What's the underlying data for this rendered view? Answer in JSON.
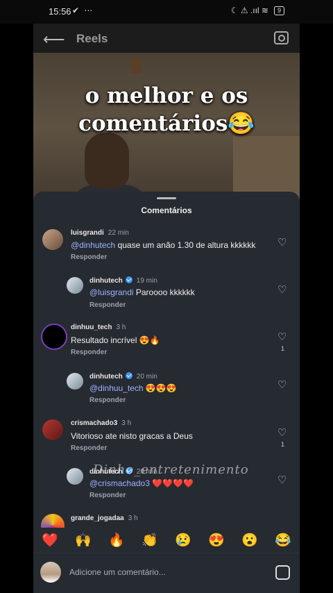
{
  "status_bar": {
    "time": "15:56",
    "left_icons": "✔ ⋯",
    "right_icons": "☾ ⚠ .ııl ≋",
    "battery": "9"
  },
  "app_bar": {
    "title": "Reels",
    "back_icon": "arrow-left-icon",
    "camera_icon": "camera-icon"
  },
  "video": {
    "overlay_line1": "o melhor e os",
    "overlay_line2": "comentários😂"
  },
  "sheet": {
    "title": "Comentários",
    "reply_label": "Responder",
    "comments": [
      {
        "user": "luisgrandi",
        "time": "22 min",
        "mention": "@dinhutech",
        "text": " quase um anão 1.30 de altura kkkkkk",
        "likes": "",
        "verified": false
      },
      {
        "user": "dinhutech",
        "time": "19 min",
        "mention": "@luisgrandi",
        "text": " Paroooo kkkkkk",
        "likes": "",
        "verified": true
      },
      {
        "user": "dinhuu_tech",
        "time": "3 h",
        "mention": "",
        "text": "Resultado incrível 😍🔥",
        "likes": "1",
        "verified": false
      },
      {
        "user": "dinhutech",
        "time": "20 min",
        "mention": "@dinhuu_tech",
        "text": " 😍😍😍",
        "likes": "",
        "verified": true
      },
      {
        "user": "crismachado3",
        "time": "3 h",
        "mention": "",
        "text": "Vitorioso ate nisto gracas a Deus",
        "likes": "1",
        "verified": false
      },
      {
        "user": "dinhutech",
        "time": "20 min",
        "mention": "@crismachado3",
        "text": " ❤️❤️❤️❤️",
        "likes": "",
        "verified": true
      },
      {
        "user": "grande_jogadaa",
        "time": "3 h",
        "mention": "",
        "text": "",
        "likes": "",
        "verified": false
      }
    ]
  },
  "watermark": "Dinho_entretenimento",
  "emoji_bar": [
    "❤️",
    "🙌",
    "🔥",
    "👏",
    "😢",
    "😍",
    "😮",
    "😂"
  ],
  "input": {
    "placeholder": "Adicione um comentário..."
  }
}
